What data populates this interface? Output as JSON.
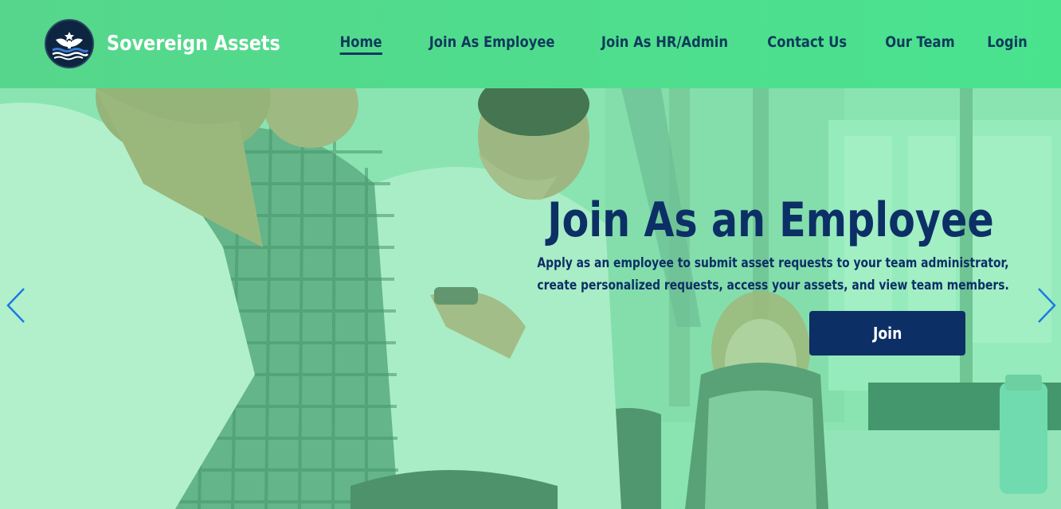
{
  "brand": {
    "name": "Sovereign Assets",
    "logo_icon": "eagle-emblem-icon"
  },
  "nav": {
    "items": [
      {
        "label": "Home",
        "active": true
      },
      {
        "label": "Join As Employee",
        "active": false
      },
      {
        "label": "Join As HR/Admin",
        "active": false
      },
      {
        "label": "Contact Us",
        "active": false
      },
      {
        "label": "Our Team",
        "active": false
      },
      {
        "label": "Login",
        "active": false
      }
    ]
  },
  "hero": {
    "title": "Join As an Employee",
    "description_line1": "Apply as an employee to submit asset requests to your team administrator,",
    "description_line2": "create personalized requests, access your assets, and view team members.",
    "button_label": "Join",
    "prev_icon": "chevron-left-icon",
    "next_icon": "chevron-right-icon"
  },
  "colors": {
    "navbar": "#4fdc8c",
    "navy": "#0c2f66",
    "arrow": "#1a7be0"
  }
}
